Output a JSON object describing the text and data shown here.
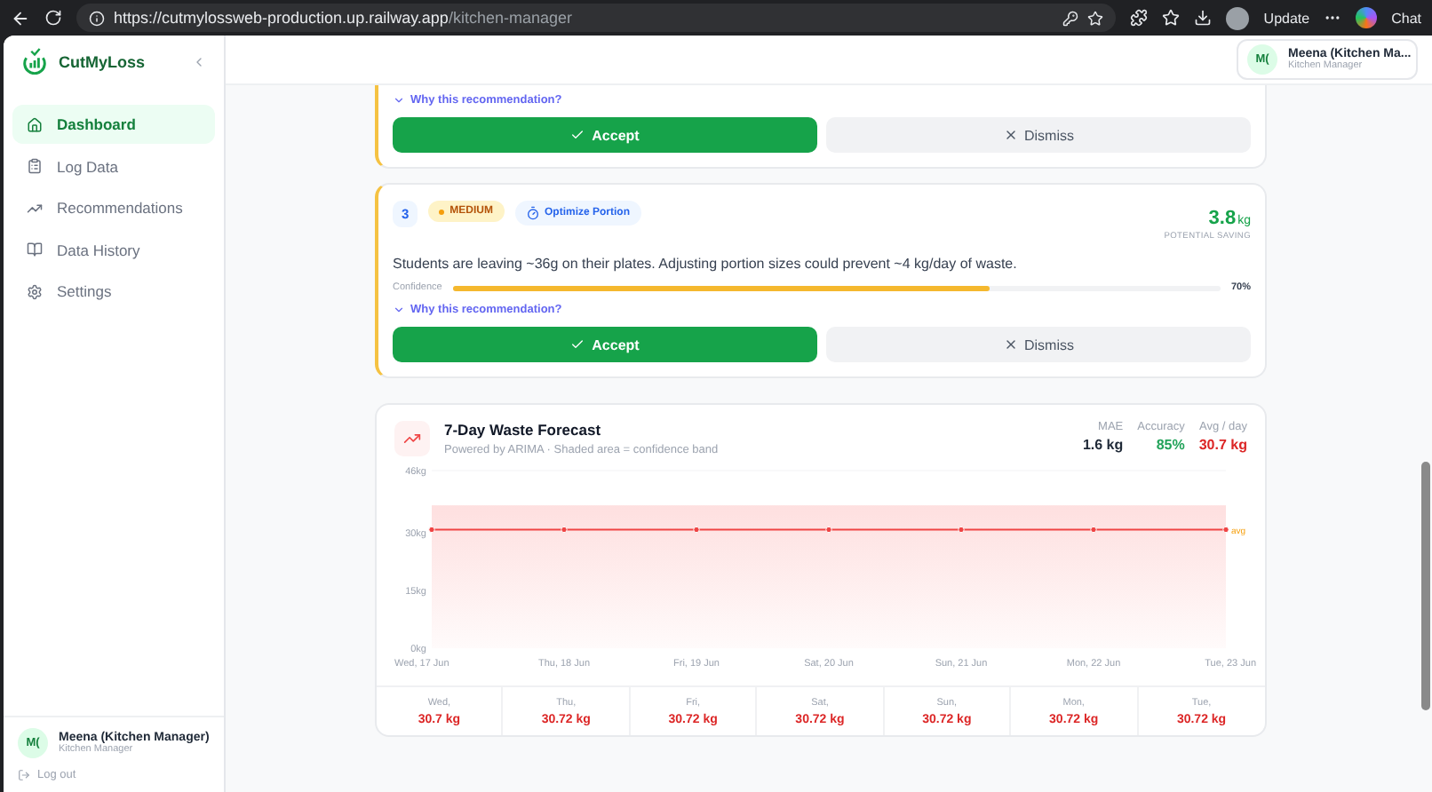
{
  "browser": {
    "url_host": "https://cutmylossweb-production.up.railway.app",
    "url_path": "/kitchen-manager",
    "update_label": "Update",
    "chat_label": "Chat"
  },
  "sidebar": {
    "brand": "CutMyLoss",
    "items": [
      {
        "label": "Dashboard",
        "selected": true
      },
      {
        "label": "Log Data",
        "selected": false
      },
      {
        "label": "Recommendations",
        "selected": false
      },
      {
        "label": "Data History",
        "selected": false
      },
      {
        "label": "Settings",
        "selected": false
      }
    ],
    "user": {
      "initials": "M(",
      "name": "Meena (Kitchen Manager)",
      "role": "Kitchen Manager"
    },
    "logout": "Log out"
  },
  "header": {
    "user": {
      "initials": "M(",
      "name": "Meena (Kitchen Ma...",
      "role": "Kitchen Manager"
    }
  },
  "recommendations": [
    {
      "why": "Why this recommendation?",
      "accept": "Accept",
      "dismiss": "Dismiss"
    },
    {
      "rank": "3",
      "priority": "MEDIUM",
      "action": "Optimize Portion",
      "saving": "3.8",
      "saving_unit": "kg",
      "saving_label": "POTENTIAL SAVING",
      "text": "Students are leaving ~36g on their plates. Adjusting portion sizes could prevent ~4 kg/day of waste.",
      "confidence_label": "Confidence",
      "level": 0.7,
      "confidence": "70%",
      "why": "Why this recommendation?",
      "accept": "Accept",
      "dismiss": "Dismiss"
    }
  ],
  "forecast": {
    "title": "7-Day Waste Forecast",
    "subtitle": "Powered by ARIMA · Shaded area = confidence band",
    "stats": [
      {
        "label": "MAE",
        "value": "1.6 kg",
        "color": "#1f2937"
      },
      {
        "label": "Accuracy",
        "value": "85%",
        "color": "#22a35a"
      },
      {
        "label": "Avg / day",
        "value": "30.7 kg",
        "color": "#dc2626"
      }
    ],
    "chart_data": {
      "type": "line",
      "categories": [
        "Wed, 17 Jun",
        "Thu, 18 Jun",
        "Fri, 19 Jun",
        "Sat, 20 Jun",
        "Sun, 21 Jun",
        "Mon, 22 Jun",
        "Tue, 23 Jun"
      ],
      "series": [
        {
          "color": "#ef4444",
          "marker": true,
          "values": [
            30.7,
            30.7,
            30.7,
            30.7,
            30.7,
            30.7,
            30.7
          ]
        }
      ],
      "ylim": [
        0,
        46
      ],
      "yticks": [
        {
          "value": 0,
          "label": "0kg"
        },
        {
          "value": 15,
          "label": "15kg"
        },
        {
          "value": 30,
          "label": "30kg"
        },
        {
          "value": 46,
          "label": "46kg"
        }
      ],
      "bands": [
        {
          "axis": "y",
          "from": 0,
          "to": 37
        }
      ],
      "annotations": [
        {
          "text": "avg"
        }
      ]
    },
    "days": [
      {
        "day": "Wed,",
        "value": "30.7 kg"
      },
      {
        "day": "Thu,",
        "value": "30.72 kg"
      },
      {
        "day": "Fri,",
        "value": "30.72 kg"
      },
      {
        "day": "Sat,",
        "value": "30.72 kg"
      },
      {
        "day": "Sun,",
        "value": "30.72 kg"
      },
      {
        "day": "Mon,",
        "value": "30.72 kg"
      },
      {
        "day": "Tue,",
        "value": "30.72 kg"
      }
    ]
  }
}
